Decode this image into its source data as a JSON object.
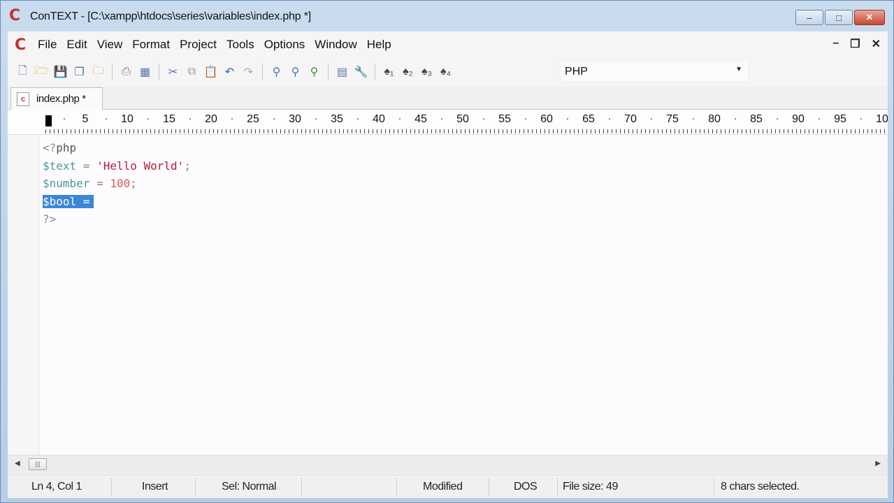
{
  "window": {
    "title": "ConTEXT - [C:\\xampp\\htdocs\\series\\variables\\index.php *]",
    "app_logo": "C",
    "controls": {
      "minimize": "‒",
      "maximize": "□",
      "close": "✕"
    }
  },
  "menu": {
    "logo": "C",
    "items": [
      "File",
      "Edit",
      "View",
      "Format",
      "Project",
      "Tools",
      "Options",
      "Window",
      "Help"
    ],
    "mdi": {
      "minimize": "–",
      "restore": "❐",
      "close": "✕"
    }
  },
  "toolbar": {
    "icons": [
      "new-file-icon",
      "open-file-icon",
      "save-icon",
      "save-all-icon",
      "open-folder-icon",
      "print-icon",
      "print-preview-icon",
      "cut-icon",
      "copy-icon",
      "paste-icon",
      "undo-icon",
      "redo-icon",
      "find-icon",
      "find-next-icon",
      "replace-icon",
      "file-properties-icon",
      "tools-icon",
      "user-command-1-icon",
      "user-command-2-icon",
      "user-command-3-icon",
      "user-command-4-icon"
    ],
    "language": "PHP"
  },
  "tabs": [
    {
      "label": "index.php *",
      "icon": "php-file-icon"
    }
  ],
  "ruler": {
    "numbers": [
      "5",
      "10",
      "15",
      "20",
      "25",
      "30",
      "35",
      "40",
      "45",
      "50",
      "55",
      "60",
      "65",
      "70",
      "75",
      "80",
      "85",
      "90",
      "95",
      "10"
    ]
  },
  "editor": {
    "lines": [
      {
        "parts": [
          [
            "tag",
            "<?"
          ],
          [
            "kw",
            "php"
          ]
        ]
      },
      {
        "parts": [
          [
            "var",
            "$text"
          ],
          [
            "op",
            " = "
          ],
          [
            "str",
            "'Hello World'"
          ],
          [
            "punc",
            ";"
          ]
        ]
      },
      {
        "parts": [
          [
            "var",
            "$number"
          ],
          [
            "op",
            " = "
          ],
          [
            "num",
            "100"
          ],
          [
            "punc",
            ";"
          ]
        ]
      },
      {
        "selected": true,
        "parts": [
          [
            "var",
            "$bool"
          ],
          [
            "op",
            " ="
          ]
        ]
      },
      {
        "parts": [
          [
            "tag",
            "?>"
          ]
        ]
      }
    ]
  },
  "statusbar": {
    "position": "Ln 4, Col 1",
    "mode": "Insert",
    "sel": "Sel: Normal",
    "modified": "Modified",
    "line_ending": "DOS",
    "file_size": "File size: 49",
    "selection": "8 chars selected."
  },
  "colors": {
    "accent": "#3b86d9",
    "variable": "#4a9a99",
    "string": "#b0203a",
    "number": "#e15a54",
    "logo": "#c9302c"
  }
}
